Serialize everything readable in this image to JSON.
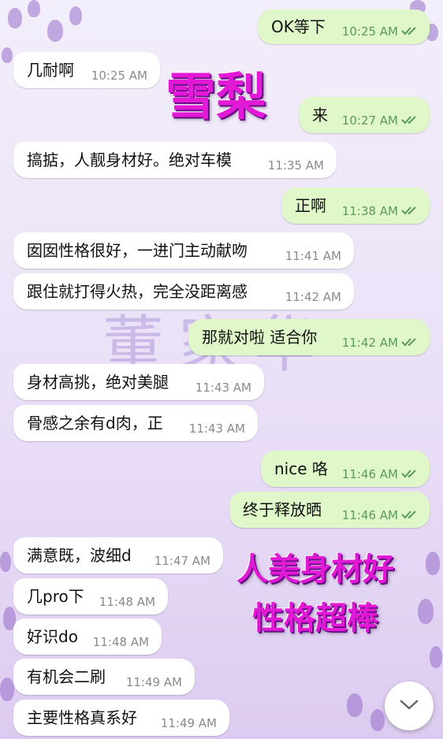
{
  "messages": [
    {
      "dir": "out",
      "text": "OK等下",
      "time": "10:25 AM"
    },
    {
      "dir": "in",
      "text": "几耐啊",
      "time": "10:25 AM"
    },
    {
      "dir": "out",
      "text": "来",
      "time": "10:27 AM"
    },
    {
      "dir": "in",
      "text": "搞掂，人靓身材好。绝对车模",
      "time": "11:35 AM"
    },
    {
      "dir": "out",
      "text": "正啊",
      "time": "11:38 AM"
    },
    {
      "dir": "in",
      "text": "囡囡性格很好，一进门主动献吻",
      "time": "11:41 AM"
    },
    {
      "dir": "in",
      "text": "跟住就打得火热，完全没距离感",
      "time": "11:42 AM"
    },
    {
      "dir": "out",
      "text": "那就对啦 适合你",
      "time": "11:42 AM"
    },
    {
      "dir": "in",
      "text": "身材高挑，绝对美腿",
      "time": "11:43 AM"
    },
    {
      "dir": "in",
      "text": "骨感之余有d肉，正",
      "time": "11:43 AM"
    },
    {
      "dir": "out",
      "text": "nice 咯",
      "time": "11:46 AM"
    },
    {
      "dir": "out",
      "text": "终于释放晒",
      "time": "11:46 AM"
    },
    {
      "dir": "in",
      "text": "满意既，波细d",
      "time": "11:47 AM"
    },
    {
      "dir": "in",
      "text": "几pro下",
      "time": "11:48 AM"
    },
    {
      "dir": "in",
      "text": "好识do",
      "time": "11:48 AM"
    },
    {
      "dir": "in",
      "text": "有机会二刷",
      "time": "11:49 AM"
    },
    {
      "dir": "in",
      "text": "主要性格真系好",
      "time": "11:49 AM"
    }
  ],
  "overlays": {
    "name": "雪梨",
    "line1": "人美身材好",
    "line2": "性格超棒",
    "watermark": "董家华"
  },
  "colors": {
    "outgoing_bubble": "#e0f7c9",
    "incoming_bubble": "#ffffff",
    "read_ticks": "#5b9a57",
    "overlay_text": "#e21ad6"
  },
  "icons": {
    "read_receipt": "double-check-icon",
    "scroll_down": "chevron-down-icon"
  }
}
